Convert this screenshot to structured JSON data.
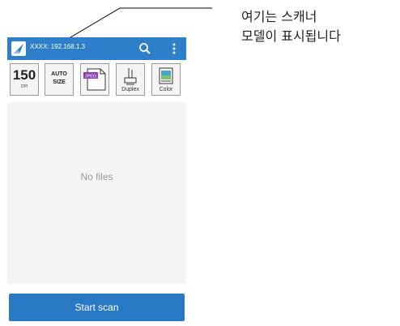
{
  "app_bar": {
    "scanner_model": "XXXX: 192.168.1.3",
    "app_icon": "scanner-app-icon",
    "search_icon": "search-icon",
    "menu_icon": "overflow-menu-icon",
    "color": "#2d7fc9"
  },
  "toolbar": {
    "resolution_value": "150",
    "resolution_unit": "DPI",
    "paper_size_line1": "AUTO",
    "paper_size_line2": "SIZE",
    "file_format_icon": "jpeg-file-icon",
    "file_format_badge": "JPEG",
    "duplex_label": "Duplex",
    "color_label": "Color"
  },
  "content": {
    "empty_message": "No files"
  },
  "actions": {
    "start_scan_label": "Start scan",
    "color": "#2878c4"
  },
  "annotation": {
    "line1": "여기는 스캐너",
    "line2": "모델이 표시됩니다"
  }
}
